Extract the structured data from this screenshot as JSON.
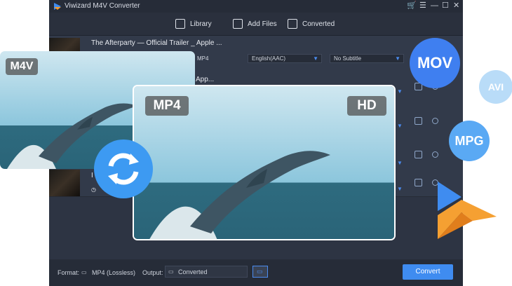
{
  "app": {
    "title": "Viwizard M4V Converter"
  },
  "toolbar": {
    "library": "Library",
    "add_files": "Add Files",
    "converted": "Converted"
  },
  "rows": [
    {
      "title": "The Afterparty — Official Trailer _ Apple ...",
      "format": "MP4",
      "audio": "English(AAC)",
      "subtitle": "No Subtitle"
    },
    {
      "title": "App..."
    },
    {
      "title": "I"
    }
  ],
  "bottom": {
    "format_label": "Format:",
    "format_value": "MP4 (Lossless)",
    "output_label": "Output:",
    "output_value": "Converted",
    "convert_label": "Convert"
  },
  "badges": {
    "m4v": "M4V",
    "mp4": "MP4",
    "hd": "HD",
    "mov": "MOV",
    "avi": "AVI",
    "mpg": "MPG"
  },
  "colors": {
    "app_bg": "#2d3443",
    "accent": "#3f8cf0",
    "mov_bubble": "#3f7ff0",
    "avi_bubble": "#b9dcf8",
    "mpg_bubble": "#5aa9f4"
  }
}
